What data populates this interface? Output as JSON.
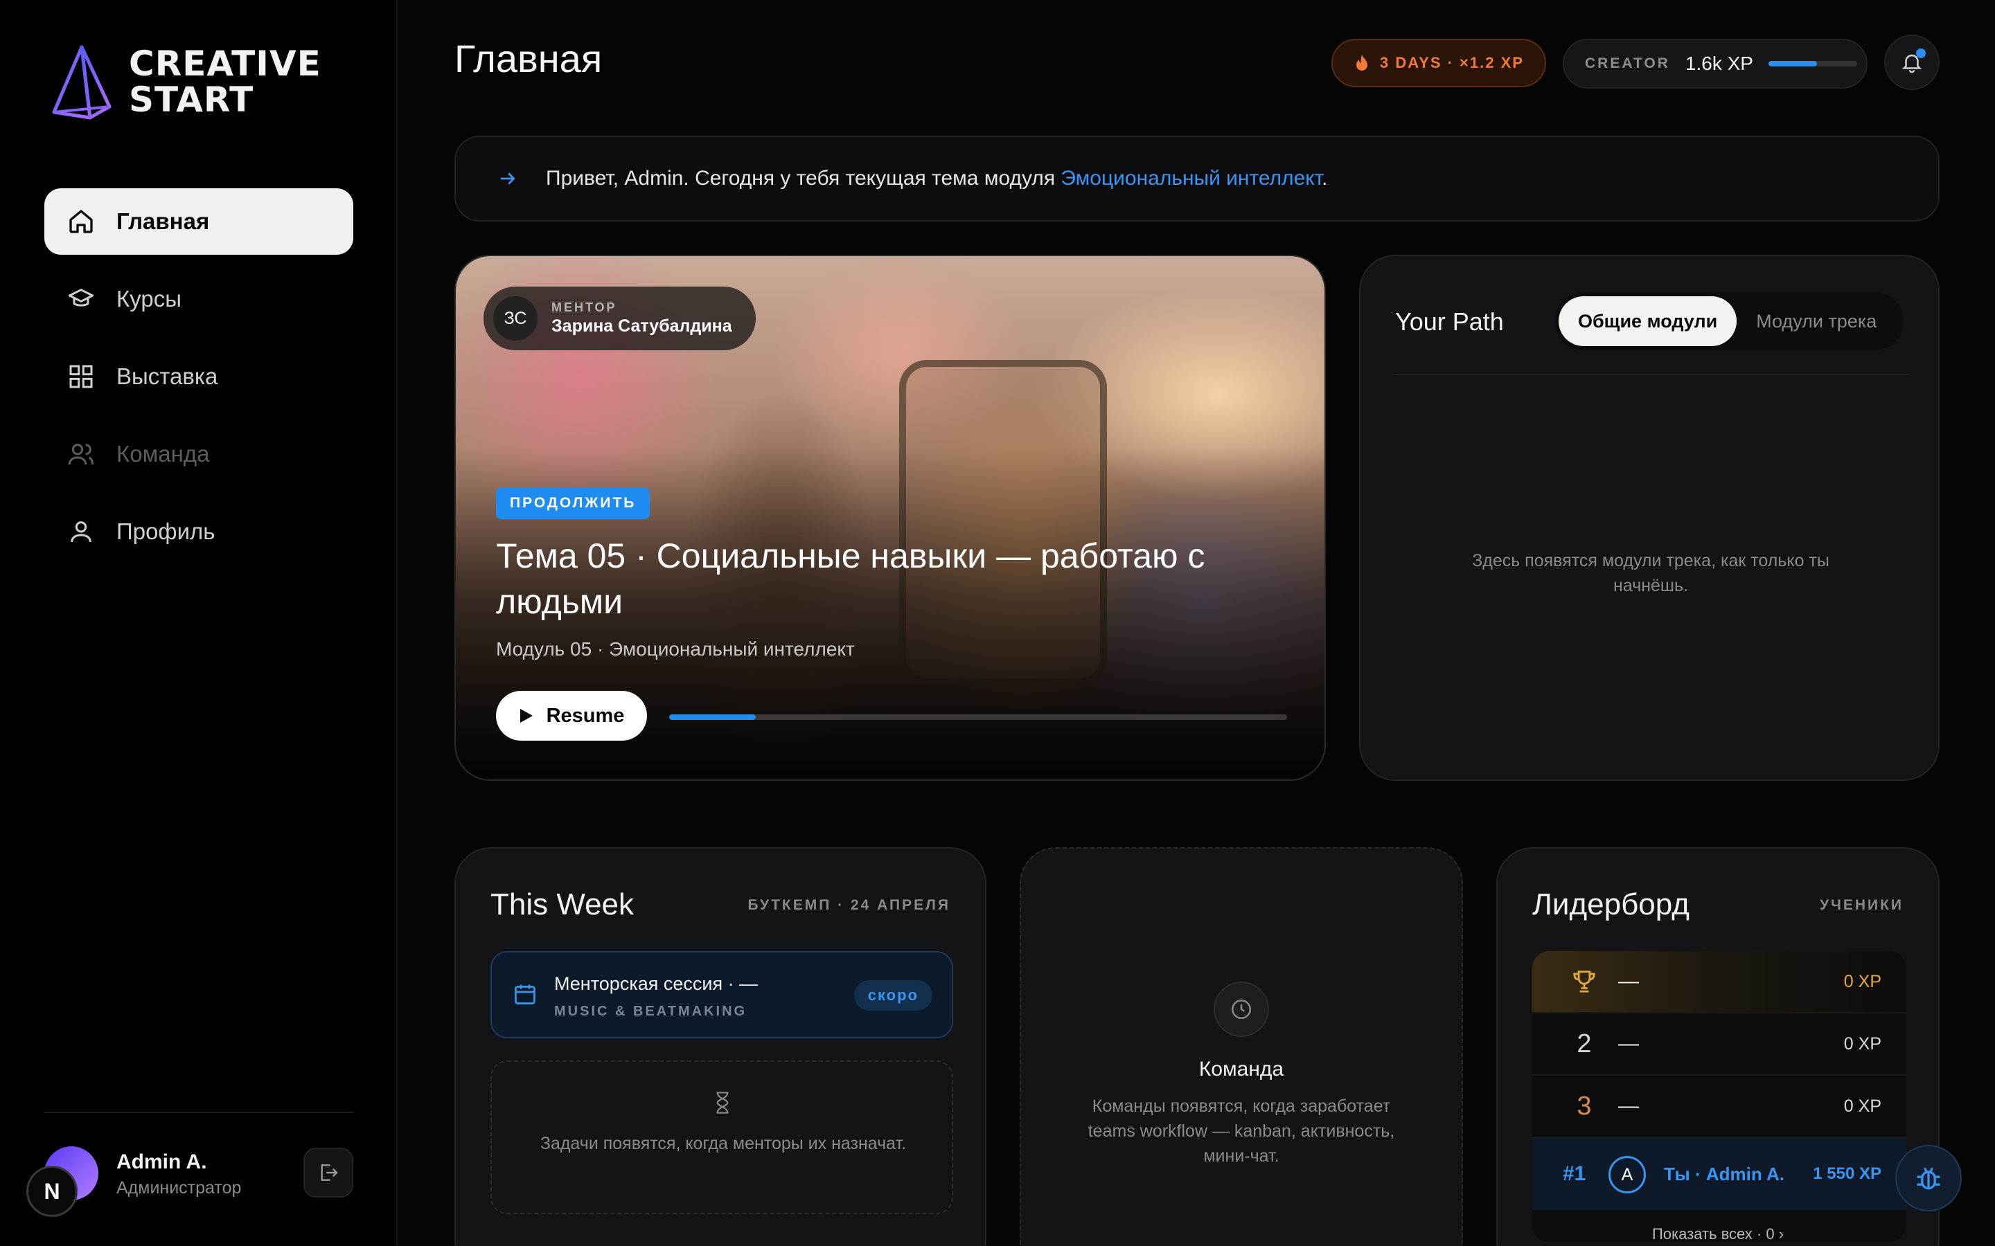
{
  "app": {
    "logo_line1": "CREATIVE",
    "logo_line2": "START"
  },
  "sidebar": {
    "items": [
      {
        "label": "Главная",
        "icon": "home-icon",
        "active": true
      },
      {
        "label": "Курсы",
        "icon": "graduation-cap-icon"
      },
      {
        "label": "Выставка",
        "icon": "grid-icon"
      },
      {
        "label": "Команда",
        "icon": "users-icon",
        "disabled": true
      },
      {
        "label": "Профиль",
        "icon": "user-icon"
      }
    ],
    "user": {
      "name": "Admin A.",
      "role": "Администратор",
      "badge_letter": "N"
    }
  },
  "header": {
    "title": "Главная",
    "streak": "3 DAYS · ×1.2 XP",
    "rank": "CREATOR",
    "xp": "1.6k XP",
    "xp_progress": 0.55
  },
  "greeting": {
    "text": "Привет, Admin. Сегодня у тебя текущая тема модуля ",
    "link": "Эмоциональный интеллект",
    "end": "."
  },
  "hero": {
    "mentor_initials": "ЗС",
    "mentor_label": "МЕНТОР",
    "mentor_name": "Зарина Сатубалдина",
    "badge": "ПРОДОЛЖИТЬ",
    "title": "Тема 05 · Социальные навыки — работаю с людьми",
    "subtitle": "Модуль 05 · Эмоциональный интеллект",
    "button": "Resume",
    "progress": 0.14
  },
  "path": {
    "title": "Your Path",
    "tabs": [
      "Общие модули",
      "Модули трека"
    ],
    "empty": "Здесь появятся модули трека, как только ты начнёшь."
  },
  "week": {
    "title": "This Week",
    "meta": "БУТКЕМП · 24 АПРЕЛЯ",
    "event_title": "Менторская сессия · —",
    "event_sub": "MUSIC & BEATMAKING",
    "event_pill": "скоро",
    "tasks_empty": "Задачи появятся, когда менторы их назначат."
  },
  "team": {
    "title": "Команда",
    "text": "Команды появятся, когда заработает teams workflow — kanban, активность, мини-чат."
  },
  "leaderboard": {
    "title": "Лидерборд",
    "meta": "УЧЕНИКИ",
    "rows": [
      {
        "rank": "",
        "name": "—",
        "xp": "0 XP"
      },
      {
        "rank": "2",
        "name": "—",
        "xp": "0 XP"
      },
      {
        "rank": "3",
        "name": "—",
        "xp": "0 XP"
      }
    ],
    "me": {
      "rank": "#1",
      "avatar": "A",
      "name": "Ты · Admin A.",
      "xp": "1 550 XP"
    },
    "show_all": "Показать всех · 0"
  }
}
